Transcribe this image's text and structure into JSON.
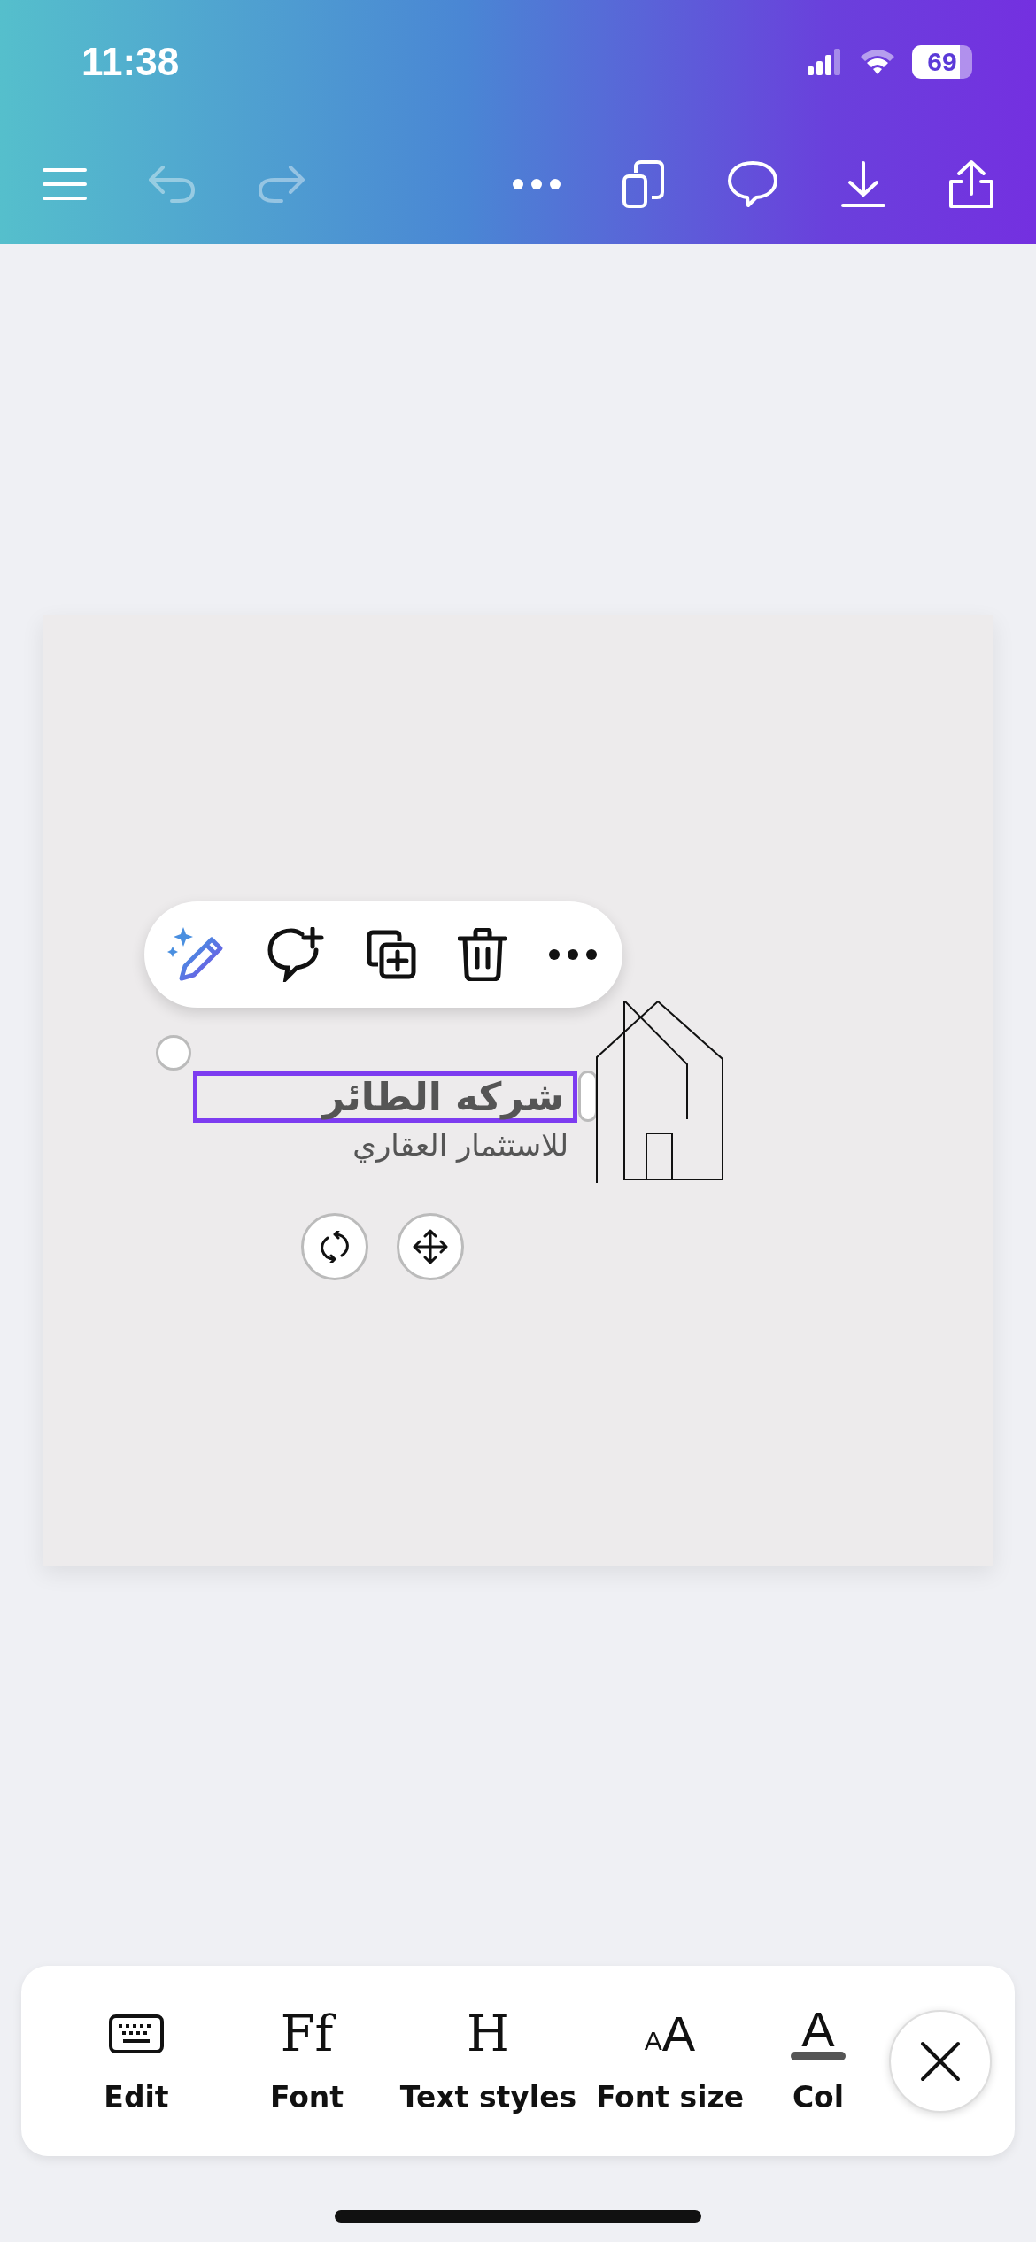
{
  "status_bar": {
    "time": "11:38",
    "battery": "69"
  },
  "top_toolbar": {
    "undo": {
      "disabled": true
    },
    "redo": {
      "disabled": true
    }
  },
  "design": {
    "texts": [
      {
        "kind": "title",
        "text": "شركه الطائر",
        "selected": true
      },
      {
        "kind": "subtitle",
        "text": "للاستثمار العقاري",
        "selected": false
      }
    ]
  },
  "bottom_toolbar": {
    "tools": [
      {
        "kind": "keyboard",
        "label": "Edit"
      },
      {
        "kind": "glyph",
        "glyph": "Ff",
        "label": "Font"
      },
      {
        "kind": "glyph",
        "glyph": "H",
        "label": "Text styles"
      },
      {
        "kind": "size",
        "glyph_small": "A",
        "glyph": "A",
        "label": "Font size"
      },
      {
        "kind": "color",
        "glyph": "A",
        "label": "Col"
      }
    ]
  }
}
